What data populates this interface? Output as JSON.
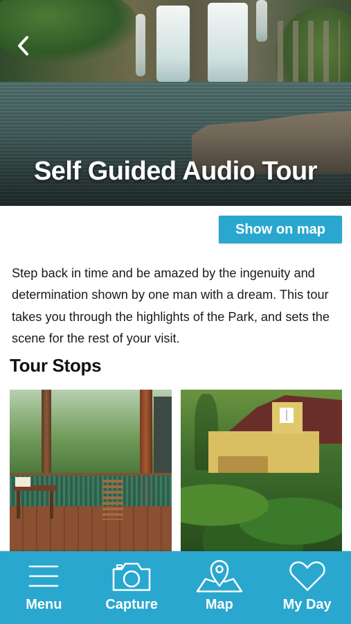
{
  "hero": {
    "title": "Self Guided Audio Tour",
    "back_icon": "chevron-left-icon"
  },
  "actions": {
    "show_on_map_label": "Show on map",
    "accent_color": "#2aa7cf"
  },
  "description": "Step back in time and be amazed by the ingenuity and determination shown by one man with a dream. This tour takes you through the highlights of the Park, and sets the scene for the rest of your visit.",
  "tour_stops": {
    "heading": "Tour Stops",
    "cards": [
      {
        "image": "timber-deck-with-trees-photo"
      },
      {
        "image": "yellow-cottage-with-garden-photo"
      }
    ]
  },
  "bottom_nav": {
    "items": [
      {
        "label": "Menu",
        "icon": "menu-icon"
      },
      {
        "label": "Capture",
        "icon": "camera-icon"
      },
      {
        "label": "Map",
        "icon": "map-icon"
      },
      {
        "label": "My Day",
        "icon": "heart-icon"
      }
    ]
  }
}
